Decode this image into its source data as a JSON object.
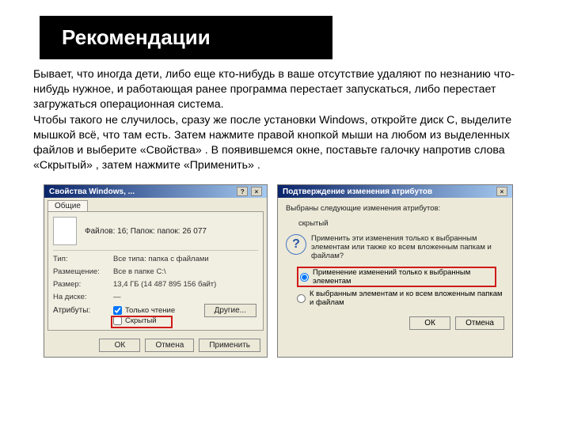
{
  "title": "Рекомендации",
  "paragraph": "Бывает, что иногда дети, либо еще кто-нибудь в ваше отсутствие удаляют по незнанию что-нибудь нужное, и работающая ранее программа перестает запускаться, либо перестает загружаться операционная система.\nЧтобы такого не случилось, сразу же после установки Windows, откройте диск С, выделите мышкой всё, что там есть. Затем нажмите правой кнопкой мыши на любом из выделенных файлов и выберите «Свойства» . В появившемся окне, поставьте галочку напротив слова «Скрытый» , затем нажмите «Применить» .",
  "leftDialog": {
    "title": "Свойства Windows, ...",
    "tab": "Общие",
    "fileSummary": "Файлов: 16; Папок: папок: 26 077",
    "labels": {
      "type": "Тип:",
      "location": "Размещение:",
      "size": "Размер:",
      "sizeOnDisk": "На диске:",
      "attributes": "Атрибуты:"
    },
    "values": {
      "type": "Все типа: папка с файлами",
      "location": "Все в папке C:\\",
      "size": "13,4 ГБ (14 487 895 156 байт)",
      "sizeOnDisk": "—"
    },
    "checkboxes": {
      "readonly": "Только чтение",
      "hidden": "Скрытый"
    },
    "otherBtn": "Другие...",
    "buttons": {
      "ok": "ОК",
      "cancel": "Отмена",
      "apply": "Применить"
    }
  },
  "rightDialog": {
    "title": "Подтверждение изменения атрибутов",
    "lead": "Выбраны следующие изменения атрибутов:",
    "attrList": "скрытый",
    "question": "Применить эти изменения только к выбранным элементам или также ко всем вложенным папкам и файлам?",
    "radios": {
      "onlySelected": "Применение изменений только к выбранным элементам",
      "withChildren": "К выбранным элементам и ко всем вложенным папкам и файлам"
    },
    "buttons": {
      "ok": "ОК",
      "cancel": "Отмена"
    }
  }
}
